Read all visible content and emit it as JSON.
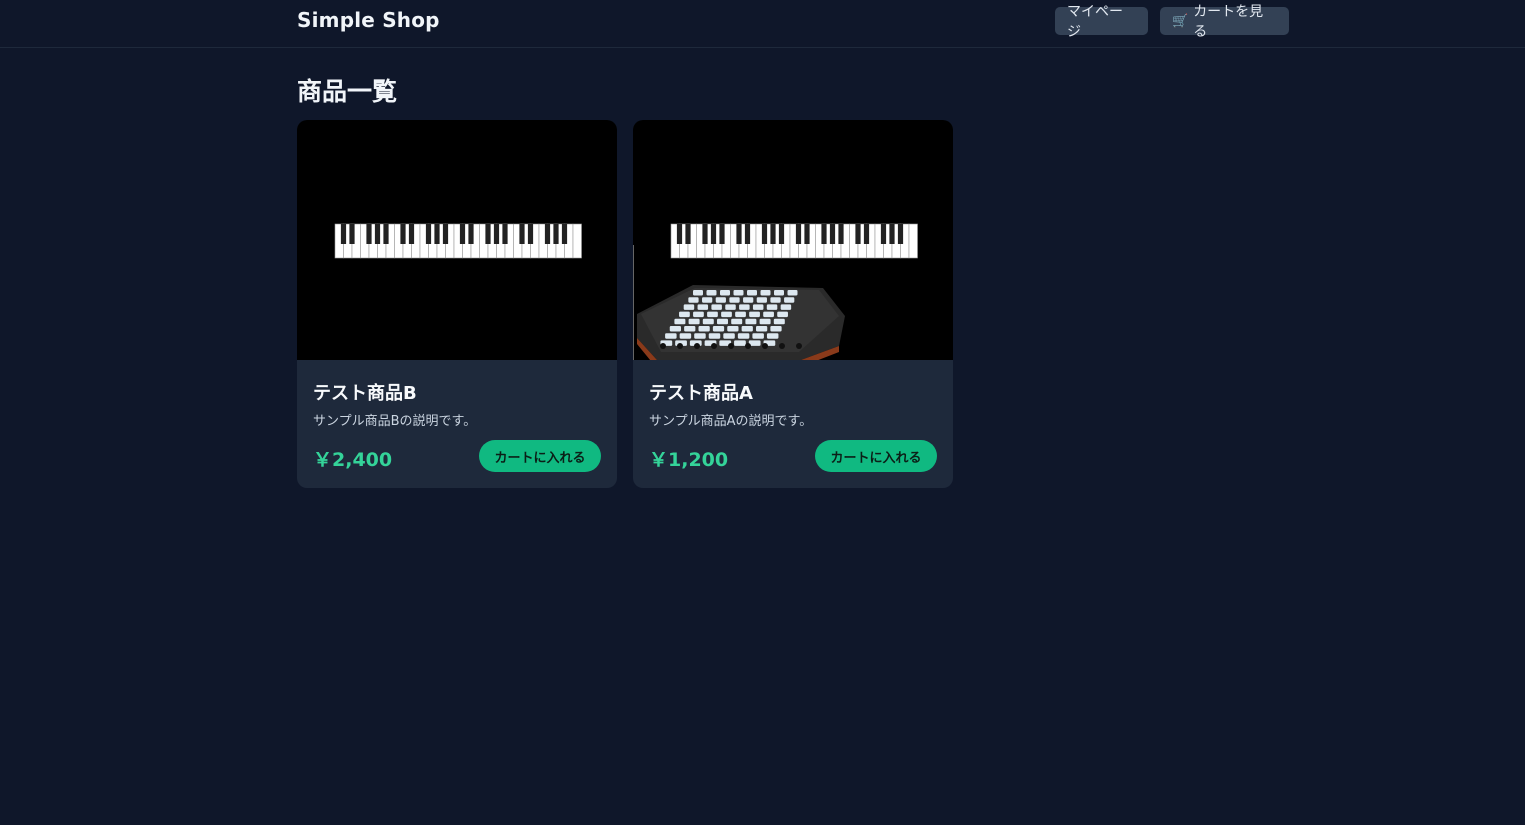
{
  "header": {
    "brand": "Simple Shop",
    "mypage_label": "マイページ",
    "cart_label": "カートを見る",
    "cart_icon": "🛒"
  },
  "main": {
    "title": "商品一覧",
    "products": [
      {
        "name": "テスト商品B",
        "description": "サンプル商品Bの説明です。",
        "price": "￥2,400",
        "button_label": "カートに入れる",
        "image": "piano-keyboard"
      },
      {
        "name": "テスト商品A",
        "description": "サンプル商品Aの説明です。",
        "price": "￥1,200",
        "button_label": "カートに入れる",
        "image": "piano-keyboard-and-launchpad"
      }
    ]
  },
  "colors": {
    "background": "#0f172a",
    "card": "#1e293b",
    "accent": "#10b981",
    "price": "#34d399"
  }
}
